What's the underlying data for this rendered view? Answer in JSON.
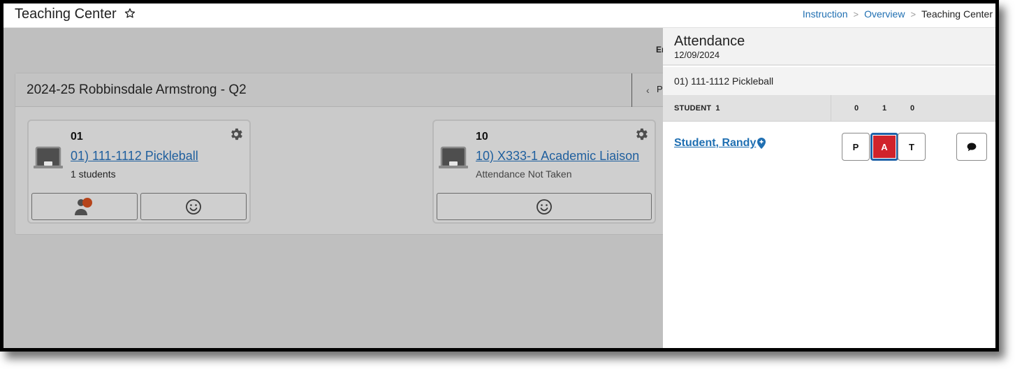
{
  "header": {
    "title": "Teaching Center",
    "breadcrumb": [
      {
        "label": "Instruction",
        "link": true
      },
      {
        "label": "Overview",
        "link": true
      },
      {
        "label": "Teaching Center",
        "link": false
      }
    ]
  },
  "main": {
    "cut_label": "Er",
    "term": {
      "title": "2024-25 Robbinsdale Armstrong - Q2",
      "prev_label": "Pr"
    },
    "sections": [
      {
        "period": "01",
        "course": "01) 111-1112 Pickleball",
        "status": "1 students",
        "actions": [
          "roster-attendance-icon",
          "smiley-icon"
        ]
      },
      {
        "period": "10",
        "course": "10) X333-1 Academic Liaison",
        "status": "Attendance Not Taken",
        "actions": [
          "smiley-icon"
        ]
      }
    ]
  },
  "attendance_panel": {
    "title": "Attendance",
    "date": "12/09/2024",
    "section": "01) 111-1112 Pickleball",
    "table_header": {
      "student_label": "STUDENT",
      "student_count": "1",
      "counts": {
        "P": "0",
        "A": "1",
        "T": "0"
      }
    },
    "students": [
      {
        "name": "Student, Randy",
        "selected": "A",
        "options": [
          "P",
          "A",
          "T"
        ]
      }
    ],
    "colors": {
      "absent_selected": "#d0232b",
      "selected_outline": "#1f62a8",
      "link": "#1f6fb2",
      "roster_badge": "#b5441b"
    }
  }
}
